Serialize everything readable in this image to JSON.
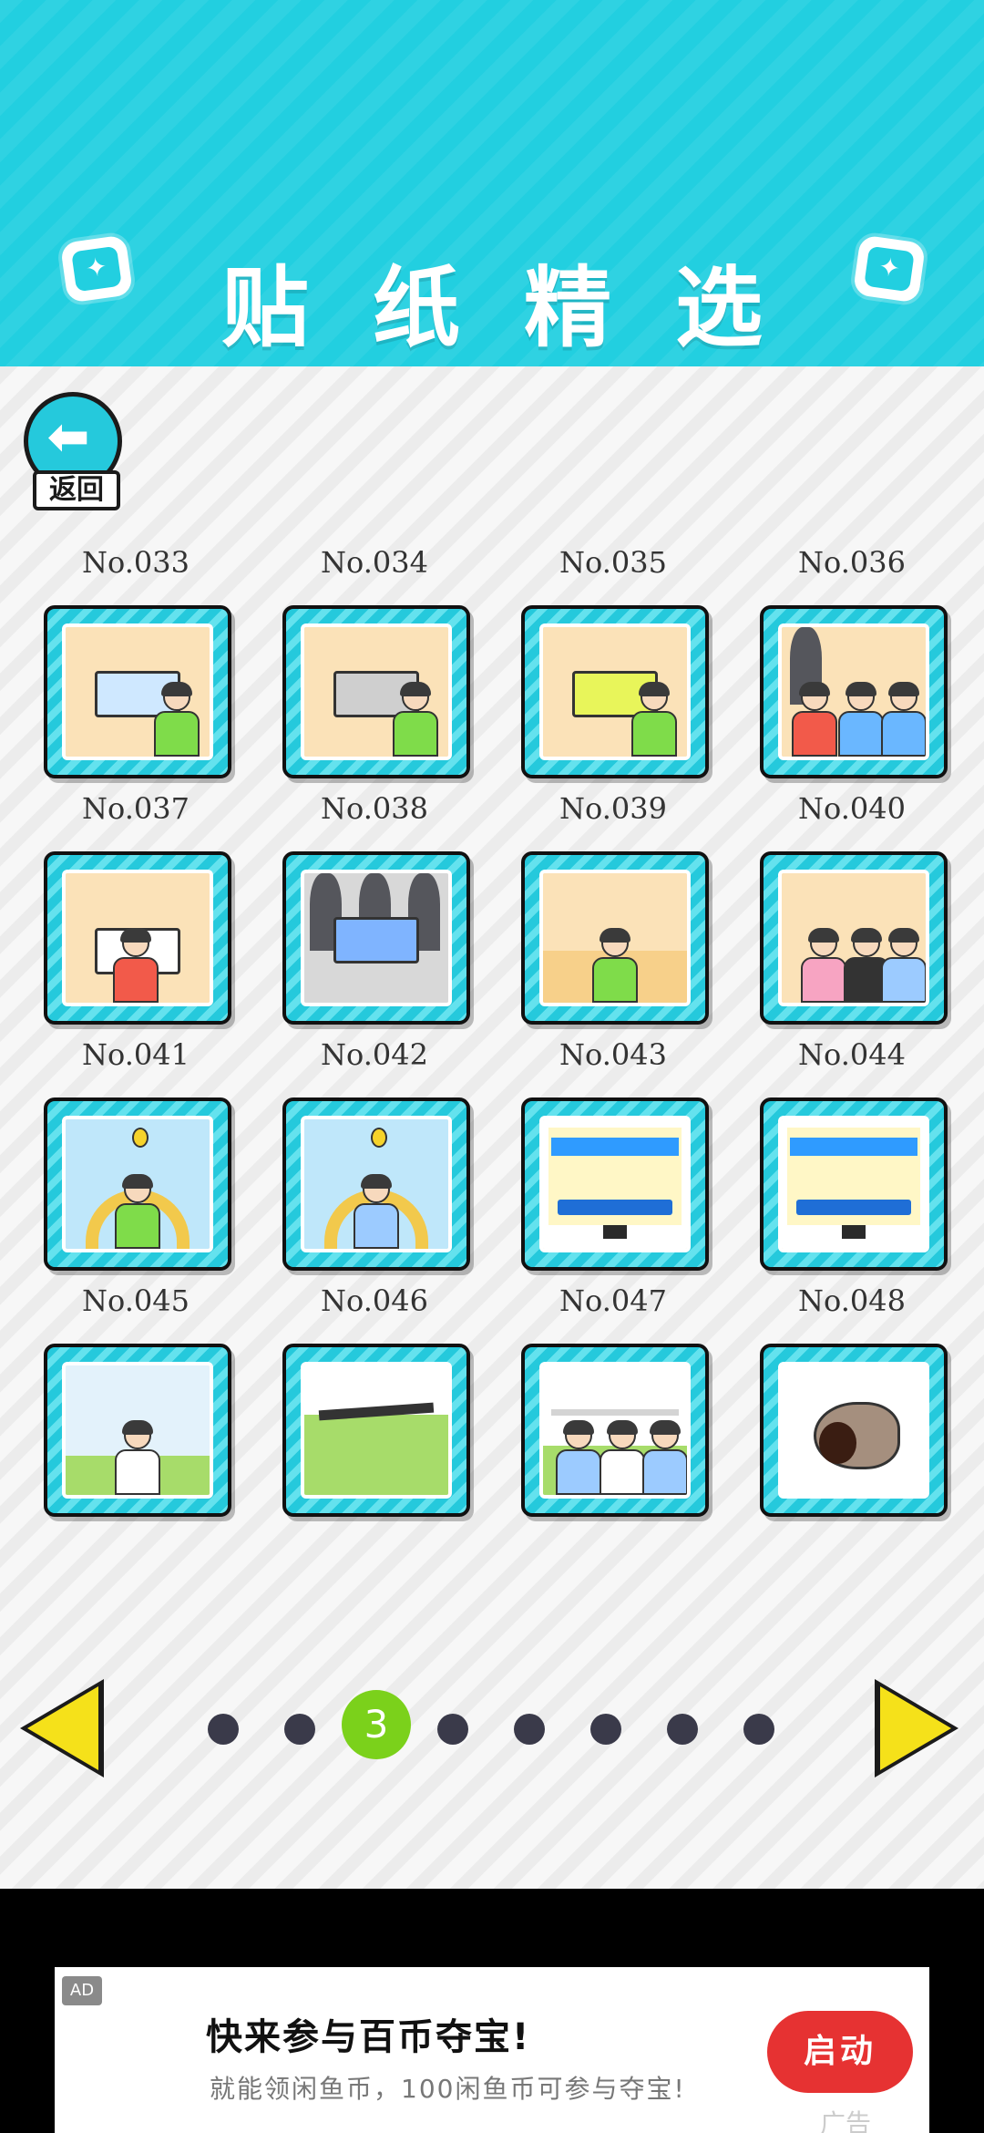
{
  "header": {
    "title": "贴纸精选"
  },
  "back": {
    "label": "返回"
  },
  "stickers": [
    {
      "label": "No.033",
      "scene": "desk-shatter"
    },
    {
      "label": "No.034",
      "scene": "desk-portrait"
    },
    {
      "label": "No.035",
      "scene": "desk-slime"
    },
    {
      "label": "No.036",
      "scene": "crowd-three"
    },
    {
      "label": "No.037",
      "scene": "desk-chain"
    },
    {
      "label": "No.038",
      "scene": "crowd-tablet"
    },
    {
      "label": "No.039",
      "scene": "singer"
    },
    {
      "label": "No.040",
      "scene": "bunny-interview"
    },
    {
      "label": "No.041",
      "scene": "balloon-arch"
    },
    {
      "label": "No.042",
      "scene": "balloon-arch-bunny"
    },
    {
      "label": "No.043",
      "scene": "tv-angry"
    },
    {
      "label": "No.044",
      "scene": "tv-bunny"
    },
    {
      "label": "No.045",
      "scene": "phone-boy"
    },
    {
      "label": "No.046",
      "scene": "fall-hole"
    },
    {
      "label": "No.047",
      "scene": "bar-exercise"
    },
    {
      "label": "No.048",
      "scene": "shell"
    }
  ],
  "pagination": {
    "current": "3",
    "total_pages": 8,
    "current_index": 3,
    "prev_icon": "triangle-left-icon",
    "next_icon": "triangle-right-icon"
  },
  "ad": {
    "tag": "AD",
    "title": "快来参与百币夺宝!",
    "subtitle": "就能领闲鱼币，100闲鱼币可参与夺宝!",
    "cta": "启动",
    "watermark": "广告"
  },
  "colors": {
    "header": "#22cfe0",
    "accent_active": "#7bd11b",
    "arrow": "#f5e11a",
    "ad_cta": "#e63232"
  }
}
